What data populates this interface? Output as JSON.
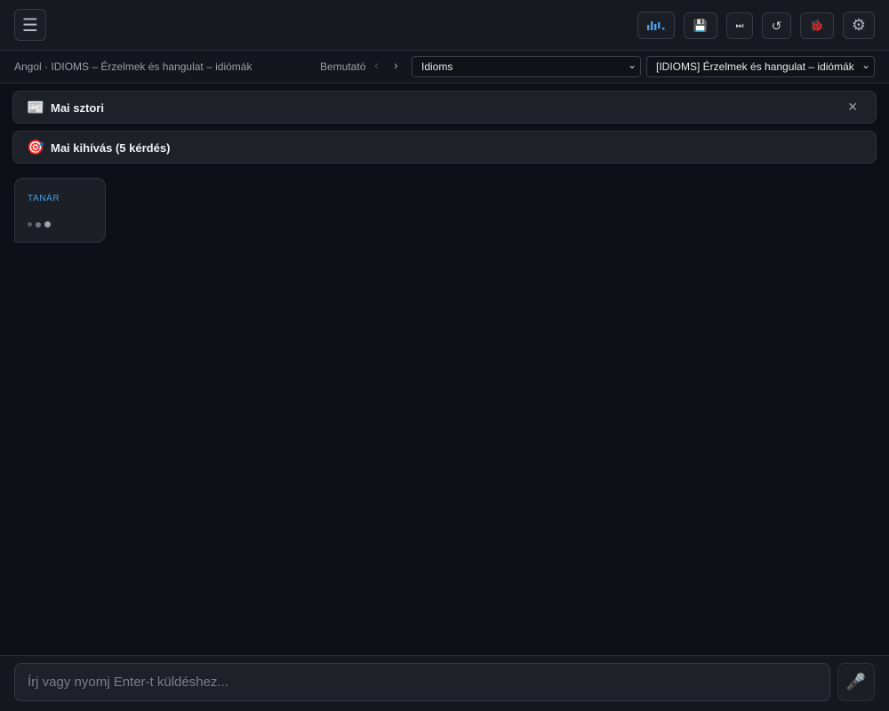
{
  "colors": {
    "background": "#0d1016",
    "topbar": "#16191f",
    "accent_blue": "#4a9fe8",
    "panel": "#1e2128"
  },
  "toolbar": {
    "menu_icon": "☰",
    "waveform_icon": "waveform-icon",
    "save_icon": "💾",
    "skip_icon": "⏭",
    "reset_icon": "↺",
    "bug_icon": "🐞",
    "settings_icon": "⚙"
  },
  "subbar": {
    "breadcrumb": "Angol · IDIOMS – Érzelmek és hangulat – idiómák",
    "demo_label": "Bemutató",
    "prev_icon": "‹",
    "next_icon": "›",
    "category_select": {
      "value": "Idioms"
    },
    "lesson_select": {
      "value": "[IDIOMS] Érzelmek és hangulat – idiómák"
    }
  },
  "panels": {
    "story": {
      "icon": "📰",
      "title": "Mai sztori",
      "close_icon": "✕"
    },
    "challenge": {
      "icon": "🎯",
      "title": "Mai kihívás (5 kérdés)"
    }
  },
  "chat": {
    "teacher_label": "TANÁR"
  },
  "composer": {
    "placeholder": "Írj vagy nyomj Enter-t küldéshez...",
    "value": "",
    "mic_icon": "🎤"
  }
}
